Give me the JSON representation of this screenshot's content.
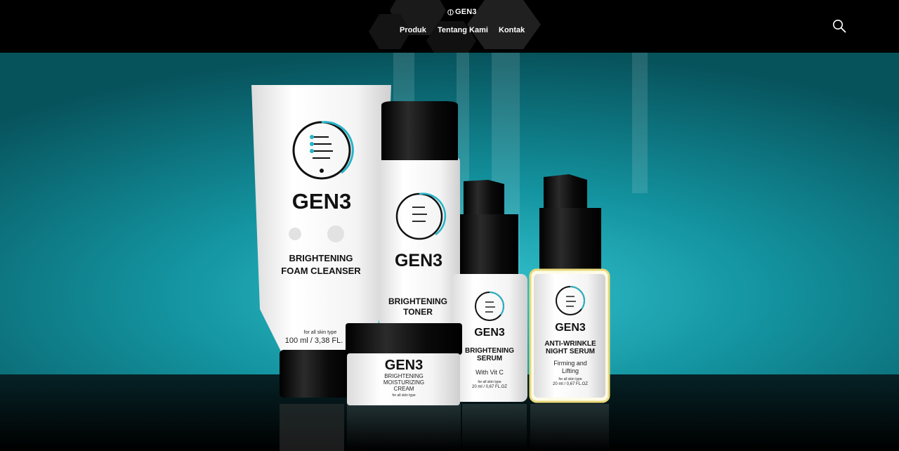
{
  "header": {
    "logo_text": "GEN3",
    "nav": [
      {
        "label": "Produk"
      },
      {
        "label": "Tentang Kami"
      },
      {
        "label": "Kontak"
      }
    ],
    "search_icon": "search-icon"
  },
  "hero": {
    "products": {
      "cleanser": {
        "brand": "GEN3",
        "line1": "BRIGHTENING",
        "line2": "FOAM CLEANSER",
        "skin": "for all skin type",
        "volume": "100 ml / 3,38 FL."
      },
      "toner": {
        "brand": "GEN3",
        "line1": "BRIGHTENING",
        "line2": "TONER"
      },
      "serum": {
        "brand": "GEN3",
        "line1": "BRIGHTENING",
        "line2": "SERUM",
        "sub": "With Vit C",
        "skin": "for all skin type",
        "volume": "20 ml / 0,67 FL.OZ"
      },
      "night_serum": {
        "brand": "GEN3",
        "line1": "ANTI-WRINKLE",
        "line2": "NIGHT SERUM",
        "sub1": "Firming and",
        "sub2": "Lifting",
        "skin": "for all skin type",
        "volume": "20 ml / 0,67 FL.OZ"
      },
      "cream": {
        "brand": "GEN3",
        "line1": "BRIGHTENING",
        "line2": "MOISTURIZING",
        "line3": "CREAM",
        "skin": "for all skin type"
      }
    }
  }
}
